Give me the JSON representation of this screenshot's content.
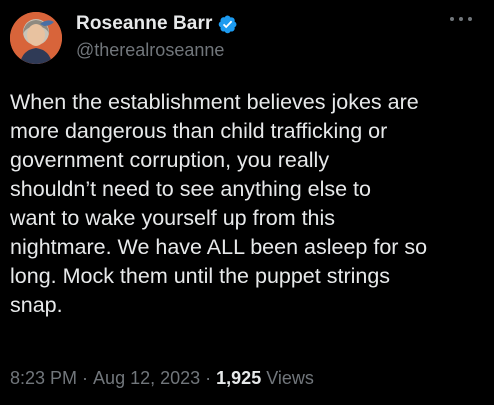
{
  "tweet": {
    "author": {
      "display_name": "Roseanne Barr",
      "handle": "@therealroseanne",
      "verified_icon": "verified-badge-icon",
      "avatar_icon": "avatar-photo"
    },
    "more_icon": "more-options-icon",
    "text": "When the establishment believes jokes are\nmore dangerous than child trafficking or\ngovernment corruption, you really\nshouldn’t need to see anything else to\nwant to wake yourself up from this\nnightmare. We have ALL been asleep for so\nlong. Mock them until the puppet strings\nsnap.",
    "meta": {
      "time": "8:23 PM",
      "separator": "·",
      "date": "Aug 12, 2023",
      "views_count": "1,925",
      "views_label": "Views"
    }
  },
  "colors": {
    "background": "#000000",
    "primary_text": "#e7e9ea",
    "secondary_text": "#71767b",
    "verified_blue": "#1d9bf0",
    "avatar_bg": "#d8643a"
  }
}
